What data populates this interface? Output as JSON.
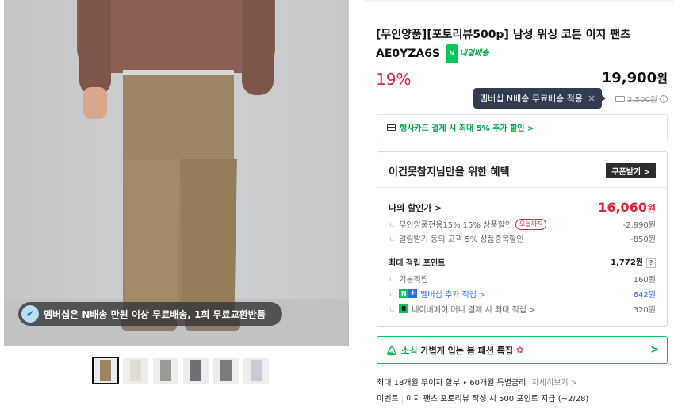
{
  "product": {
    "title_line1": "[무인양품][포토리뷰500p] 남성 워싱 코튼 이지 팬츠",
    "code": "AE0YZA6S",
    "delivery_badge_n": "N",
    "delivery_badge_text": "내일배송"
  },
  "price": {
    "discount": "19%",
    "amount": "19,900",
    "won": "원",
    "tooltip": "멤버십 N배송 무료배송 적용",
    "tooltip_close": "×",
    "shipping_fee": "3,500원",
    "info": "i"
  },
  "card_promo": "행사카드 결제 시 최대 5% 추가 할인 >",
  "image": {
    "membership_banner": "멤버십은 N배송 만원 이상 무료배송, 1회 무료교환반품",
    "thumb_colors": [
      "#9b8563",
      "#e2ddcc",
      "#9a9a94",
      "#6d7178",
      "#7a7e7a",
      "#c3cbd8"
    ]
  },
  "benefit": {
    "heading": "이건못참지님만을 위한 혜택",
    "coupon_button": "쿠폰받기 >",
    "my_price_label": "나의 할인가 >",
    "my_price_value": "16,060",
    "my_price_won": "원",
    "discount_items": [
      {
        "label": "무인양품전용15% 15% 상품할인",
        "tag": "오늘까지",
        "value": "-2,990원"
      },
      {
        "label": "알림받기 동의 고객 5% 상품중복할인",
        "value": "-850원"
      }
    ],
    "points_label": "최대 적립 포인트",
    "points_value": "1,772원",
    "points_help": "?",
    "point_items": [
      {
        "label": "기본적립",
        "value": "160원"
      },
      {
        "label": "멤버십 추가 적립 >",
        "value": "642원"
      },
      {
        "label": "네이버페이 머니 결제 시 최대 적립 >",
        "value": "320원"
      }
    ]
  },
  "news": {
    "label": "소식",
    "text": "가볍게 입는 봄 패션 특집",
    "flower": "✿",
    "chevron": ">"
  },
  "installment": {
    "text": "최대 18개월 무이자 할부 • 60개월 특별금리",
    "more": "자세히보기 >"
  },
  "event": {
    "label": "이벤트",
    "text": "이지 팬츠 포토리뷰 작성 시 500 포인트 지급 (~2/28)"
  },
  "colors": {
    "accent_green": "#03c75a",
    "discount_red": "#e0233d",
    "link_blue": "#2e6bf0"
  }
}
